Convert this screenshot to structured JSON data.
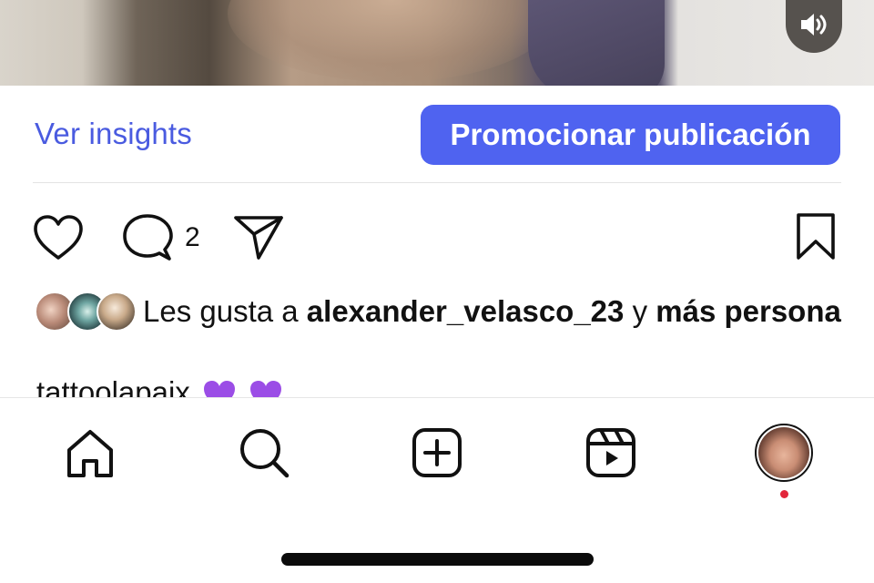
{
  "post": {
    "sound_icon": "speaker-icon",
    "insights_label": "Ver insights",
    "promote_label": "Promocionar publicación",
    "comment_count": "2"
  },
  "likes": {
    "prefix": "Les gusta a",
    "user": "alexander_velasco_23",
    "connector": "y",
    "others": "más persona"
  },
  "caption": {
    "text": "tattoolapaix"
  },
  "colors": {
    "accent_link": "#4a5be0",
    "accent_button": "#4f63f0",
    "notification_dot": "#e2263b",
    "heart_emoji": "#9b4de6"
  },
  "nav": {
    "items": [
      "home-icon",
      "search-icon",
      "create-icon",
      "reels-icon",
      "profile-avatar"
    ]
  }
}
